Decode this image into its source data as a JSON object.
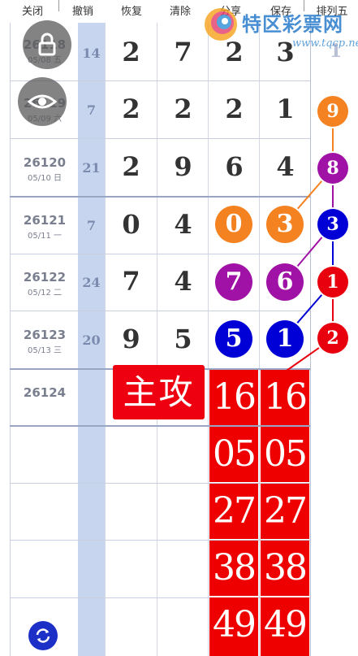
{
  "toolbar": {
    "close": "关闭",
    "undo": "撤销",
    "redo": "恢复",
    "clear": "清除",
    "share": "分享",
    "save": "保存",
    "mode": "排列五"
  },
  "watermark": {
    "brand": "特区彩票网",
    "url": "www.tqcp.net"
  },
  "rows": [
    {
      "issue": "26118",
      "date": "05/08 五",
      "sum": "14",
      "digits": [
        "2",
        "7",
        "2",
        "3"
      ],
      "last": "1"
    },
    {
      "issue": "26119",
      "date": "05/09 六",
      "sum": "7",
      "digits": [
        "2",
        "2",
        "2",
        "1"
      ],
      "last": "9"
    },
    {
      "issue": "26120",
      "date": "05/10 日",
      "sum": "21",
      "digits": [
        "2",
        "9",
        "6",
        "4"
      ],
      "last": "8"
    },
    {
      "issue": "26121",
      "date": "05/11 一",
      "sum": "7",
      "digits": [
        "0",
        "4",
        "0",
        "3"
      ],
      "last": "3"
    },
    {
      "issue": "26122",
      "date": "05/12 二",
      "sum": "24",
      "digits": [
        "7",
        "4",
        "7",
        "6"
      ],
      "last": "1"
    },
    {
      "issue": "26123",
      "date": "05/13 三",
      "sum": "20",
      "digits": [
        "9",
        "5",
        "5",
        "1"
      ],
      "last": "2"
    },
    {
      "issue": "26124",
      "date": "",
      "sum": "",
      "digits": [],
      "last": ""
    }
  ],
  "main_label": "主攻",
  "picks": {
    "col4": [
      "16",
      "05",
      "27",
      "38",
      "49"
    ],
    "col5": [
      "16",
      "05",
      "27",
      "38",
      "49"
    ]
  },
  "colors": {
    "orange": "#f58220",
    "purple": "#a012a6",
    "blue": "#0000d6",
    "red": "#ee0000",
    "sum_col": "#c7d6ee"
  },
  "icons": {
    "lock": "lock-icon",
    "eye": "eye-icon",
    "refresh": "refresh-icon"
  }
}
